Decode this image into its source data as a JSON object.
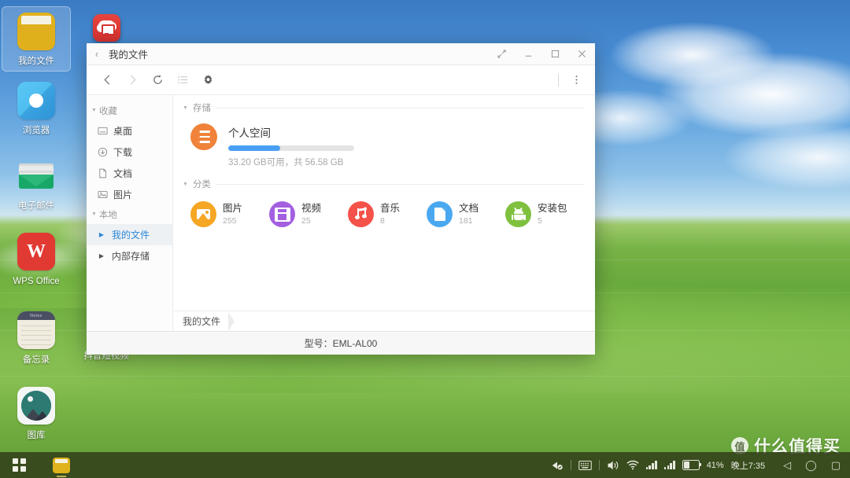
{
  "desktop": {
    "icons": [
      {
        "label": "我的文件",
        "icon": "folder-icon",
        "selected": true
      },
      {
        "label": "浏览器",
        "icon": "browser-icon",
        "selected": false
      },
      {
        "label": "电子邮件",
        "icon": "mail-icon",
        "selected": false
      },
      {
        "label": "WPS Office",
        "icon": "wps-office-icon",
        "selected": false
      },
      {
        "label": "备忘录",
        "icon": "notes-icon",
        "selected": false
      },
      {
        "label": "图库",
        "icon": "gallery-icon",
        "selected": false
      }
    ],
    "partially_hidden_label": "抖音短视频",
    "notes_icon_header": "Notes"
  },
  "window": {
    "app_icon": "remote-desktop-cloud-icon",
    "title": "我的文件",
    "back_chevron": "‹",
    "controls": {
      "expand": "⤢",
      "minimize": "—",
      "maximize": "▢",
      "close": "✕"
    },
    "toolbar": {
      "back": "‹",
      "forward": "›",
      "refresh": "⟳",
      "list_view": "list-view-icon",
      "settings": "gear-icon",
      "more": "⋮"
    },
    "sidebar": {
      "groups": [
        {
          "title": "收藏",
          "items": [
            {
              "label": "桌面",
              "icon": "desktop-icon",
              "active": false,
              "expandable": false
            },
            {
              "label": "下载",
              "icon": "download-icon",
              "active": false,
              "expandable": false
            },
            {
              "label": "文档",
              "icon": "document-icon",
              "active": false,
              "expandable": false
            },
            {
              "label": "图片",
              "icon": "picture-icon",
              "active": false,
              "expandable": false
            }
          ]
        },
        {
          "title": "本地",
          "items": [
            {
              "label": "我的文件",
              "icon": "triangle-icon",
              "active": true,
              "expandable": true
            },
            {
              "label": "内部存储",
              "icon": "triangle-icon",
              "active": false,
              "expandable": true
            }
          ]
        }
      ]
    },
    "storage_section": {
      "title": "存储",
      "name": "个人空间",
      "icon": "storage-icon",
      "used_percent": 41,
      "detail": "33.20 GB可用，共 56.58 GB",
      "bar_color": "#4a9ff5"
    },
    "categories_section": {
      "title": "分类",
      "items": [
        {
          "label": "图片",
          "count": "255",
          "icon": "picture-category-icon",
          "color": "#f5a623"
        },
        {
          "label": "视频",
          "count": "25",
          "icon": "video-category-icon",
          "color": "#a35fe0"
        },
        {
          "label": "音乐",
          "count": "8",
          "icon": "music-category-icon",
          "color": "#f5524a"
        },
        {
          "label": "文档",
          "count": "181",
          "icon": "document-category-icon",
          "color": "#4aa8f0"
        },
        {
          "label": "安装包",
          "count": "5",
          "icon": "apk-category-icon",
          "color": "#7fc13f"
        }
      ]
    },
    "breadcrumb": "我的文件",
    "footer": "型号：EML-AL00"
  },
  "taskbar": {
    "apps_button": "apps-grid-icon",
    "running_app": "file-manager-folder-icon",
    "tray": {
      "sync": "sync-check-icon",
      "keyboard": "keyboard-icon",
      "volume": "volume-icon",
      "wifi": "wifi-icon",
      "signal1": "signal-bars-icon",
      "signal2": "signal-bars-icon",
      "battery": "battery-icon",
      "battery_percent": "41%",
      "clock": "晚上7:35"
    },
    "nav": {
      "back": "◁",
      "home": "◯",
      "recents": "▢"
    }
  },
  "watermark": {
    "badge": "值",
    "text": "什么值得买"
  }
}
